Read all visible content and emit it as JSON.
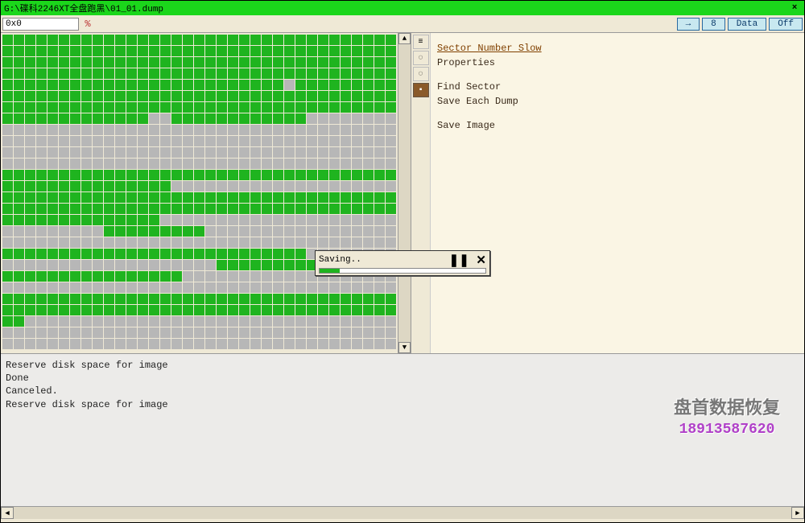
{
  "titlebar": {
    "title": "G:\\碟科2246XT全盘跑黑\\01_01.dump",
    "close": "×"
  },
  "toolbar": {
    "address": "0x0",
    "btn_arrow": "→",
    "btn_width": "8",
    "btn_data": "Data",
    "btn_off": "Off"
  },
  "sidemenu": {
    "items": [
      {
        "label": "Sector Number Slow",
        "active": true
      },
      {
        "label": "Properties",
        "active": false
      }
    ],
    "items2": [
      {
        "label": "Find Sector"
      },
      {
        "label": "Save Each Dump"
      }
    ],
    "items3": [
      {
        "label": "Save Image"
      }
    ]
  },
  "dialog": {
    "label": "Saving..",
    "progress_pct": 12
  },
  "log": {
    "lines": [
      "Reserve disk space for image",
      "Done",
      "Canceled.",
      "Reserve disk space for image"
    ]
  },
  "watermark": {
    "text": "盘首数据恢复",
    "phone": "18913587620"
  },
  "grid": {
    "cols": 35,
    "rows_encoded": [
      "GGGGGGGGGGGGGGGGGGGGGGGGGGGGGGGGGGG",
      "GGGGGGGGGGGGGGGGGGGGGGGGGGGGGGGGGGG",
      "GGGGGGGGGGGGGGGGGGGGGGGGGGGGGGGGGGG",
      "GGGGGGGGGGGGGGGGGGGGGGGGGGGGGGGGGGG",
      "GGGGGGGGGGGGGGGGGGGGGGGGGXGGGGGGGGG",
      "GGGGGGGGGGGGGGGGGGGGGGGGGGGGGGGGGGG",
      "GGGGGGGGGGGGGGGGGGGGGGGGGGGGGGGGGGG",
      "GGGGGGGGGGGGGXXGGGGGGGGGGGGXXXXXXXX",
      "XXXXXXXXXXXXXXXXXXXXXXXXXXXXXXXXXXX",
      "XXXXXXXXXXXXXXXXXXXXXXXXXXXXXXXXXXX",
      "XXXXXXXXXXXXXXXXXXXXXXXXXXXXXXXXXXX",
      "XXXXXXXXXXXXXXXXXXXXXXXXXXXXXXXXXXX",
      "GGGGGGGGGGGGGGGGGGGGGGGGGGGGGGGGGGG",
      "GGGGGGGGGGGGGGGXXXXXXXXXXXXXXXXXXXX",
      "GGGGGGGGGGGGGGGGGGGGGGGGGGGGGGGGGGG",
      "GGGGGGGGGGGGGGGGGGGGGGGGGGGGGGGGGGG",
      "GGGGGGGGGGGGGGXXXXXXXXXXXXXXXXXXXXX",
      "XXXXXXXXXGGGGGGGGGXXXXXXXXXXXXXXXXX",
      "XXXXXXXXXXXXXXXXXXXXXXXXXXXXXXXXXXX",
      "GGGGGGGGGGGGGGGGGGGGGGGGGGGXXXXXXXX",
      "XXXXXXXXXXXXXXXXXXXGGGGGGGGGGGGGGGG",
      "GGGGGGGGGGGGGGGGXXXXXXXXXXXXXXXXXXX",
      "XXXXXXXXXXXXXXXXXXXXXXXXXXXXXXXXXXX",
      "GGGGGGGGGGGGGGGGGGGGGGGGGGGGGGGGGGG",
      "GGGGGGGGGGGGGGGGGGGGGGGGGGGGGGGGGGG",
      "GGXXXXXXXXXXXXXXXXXXXXXXXXXXXXXXXXX",
      "XXXXXXXXXXXXXXXXXXXXXXXXXXXXXXXXXXX",
      "XXXXXXXXXXXXXXXXXXXXXXXXXXXXXXXXXXX"
    ]
  }
}
